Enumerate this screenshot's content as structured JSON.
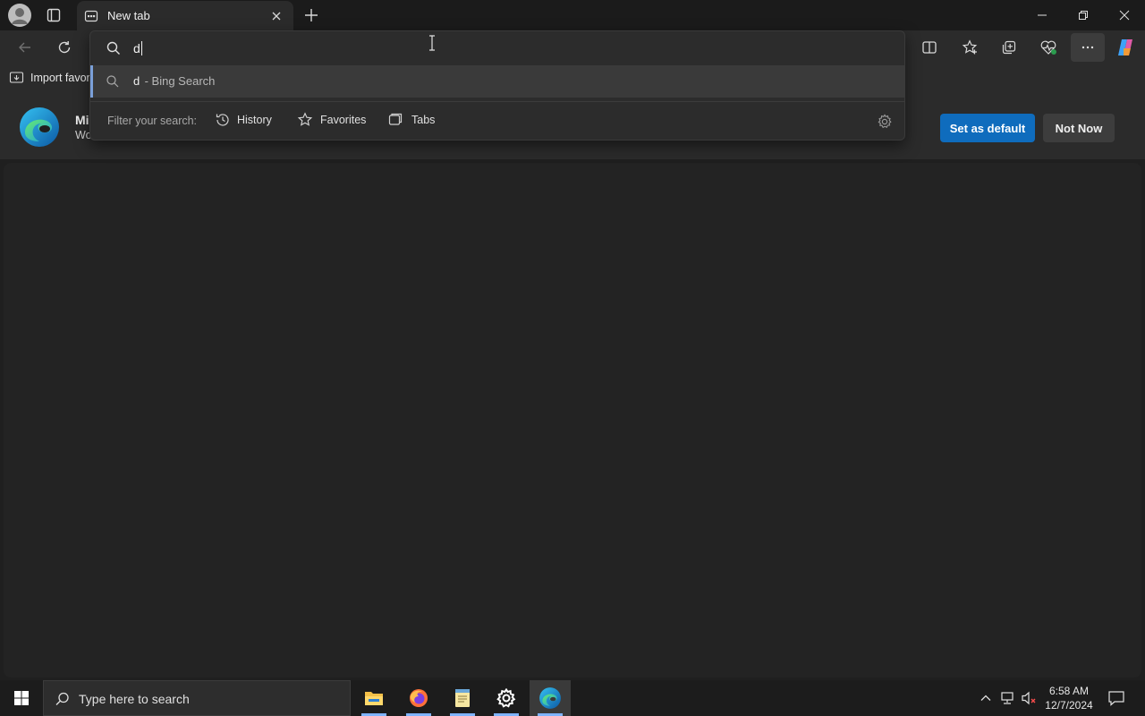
{
  "tab": {
    "title": "New tab"
  },
  "omnibox": {
    "query": "d",
    "suggestion": {
      "query": "d",
      "suffix": " - Bing Search"
    },
    "filter_label": "Filter your search:",
    "filters": [
      {
        "label": "History",
        "icon": "history-icon"
      },
      {
        "label": "Favorites",
        "icon": "star-icon"
      },
      {
        "label": "Tabs",
        "icon": "tabs-icon"
      }
    ]
  },
  "favorites_bar": {
    "import_label": "Import favor"
  },
  "banner": {
    "title_partial": "Mi",
    "subtitle_partial": "Wo",
    "primary_button": "Set as default",
    "secondary_button": "Not Now"
  },
  "taskbar": {
    "search_placeholder": "Type here to search",
    "time": "6:58 AM",
    "date": "12/7/2024"
  },
  "colors": {
    "accent": "#0f6cbd",
    "suggestion_accent": "#7a9fd8",
    "taskbar_active": "#7fb4ff"
  }
}
